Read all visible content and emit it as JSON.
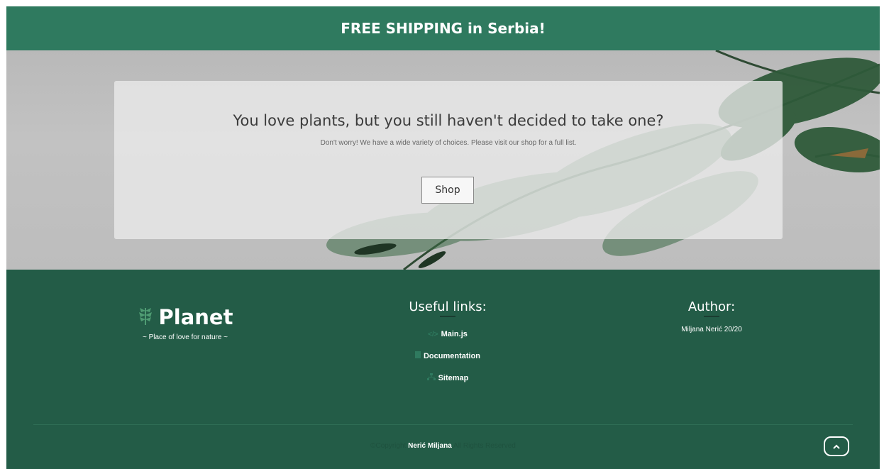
{
  "banner": {
    "text": "FREE SHIPPING in Serbia!"
  },
  "hero": {
    "title": "You love plants, but you still haven't decided to take one?",
    "subtitle": "Don't worry! We have a wide variety of choices. Please visit our shop for a full list.",
    "shop_label": "Shop"
  },
  "footer": {
    "brand": {
      "name": "Planet",
      "tagline": "~ Place of love for nature ~",
      "icon": "leaf-icon"
    },
    "links": {
      "heading": "Useful links:",
      "items": [
        {
          "label": "Main.js",
          "icon": "code-icon"
        },
        {
          "label": "Documentation",
          "icon": "document-icon"
        },
        {
          "label": "Sitemap",
          "icon": "sitemap-icon"
        }
      ]
    },
    "author": {
      "heading": "Author:",
      "text": "Miljana Nerić 20/20"
    },
    "copyright": {
      "prefix": "©Copyright",
      "name": "Nerić Miljana",
      "suffix": "All Rights Reserved"
    },
    "back_to_top": {
      "icon": "chevron-up-icon"
    }
  },
  "colors": {
    "banner": "#2f7a5f",
    "footer": "#235c47",
    "hero_background": "#bdbdbd"
  }
}
